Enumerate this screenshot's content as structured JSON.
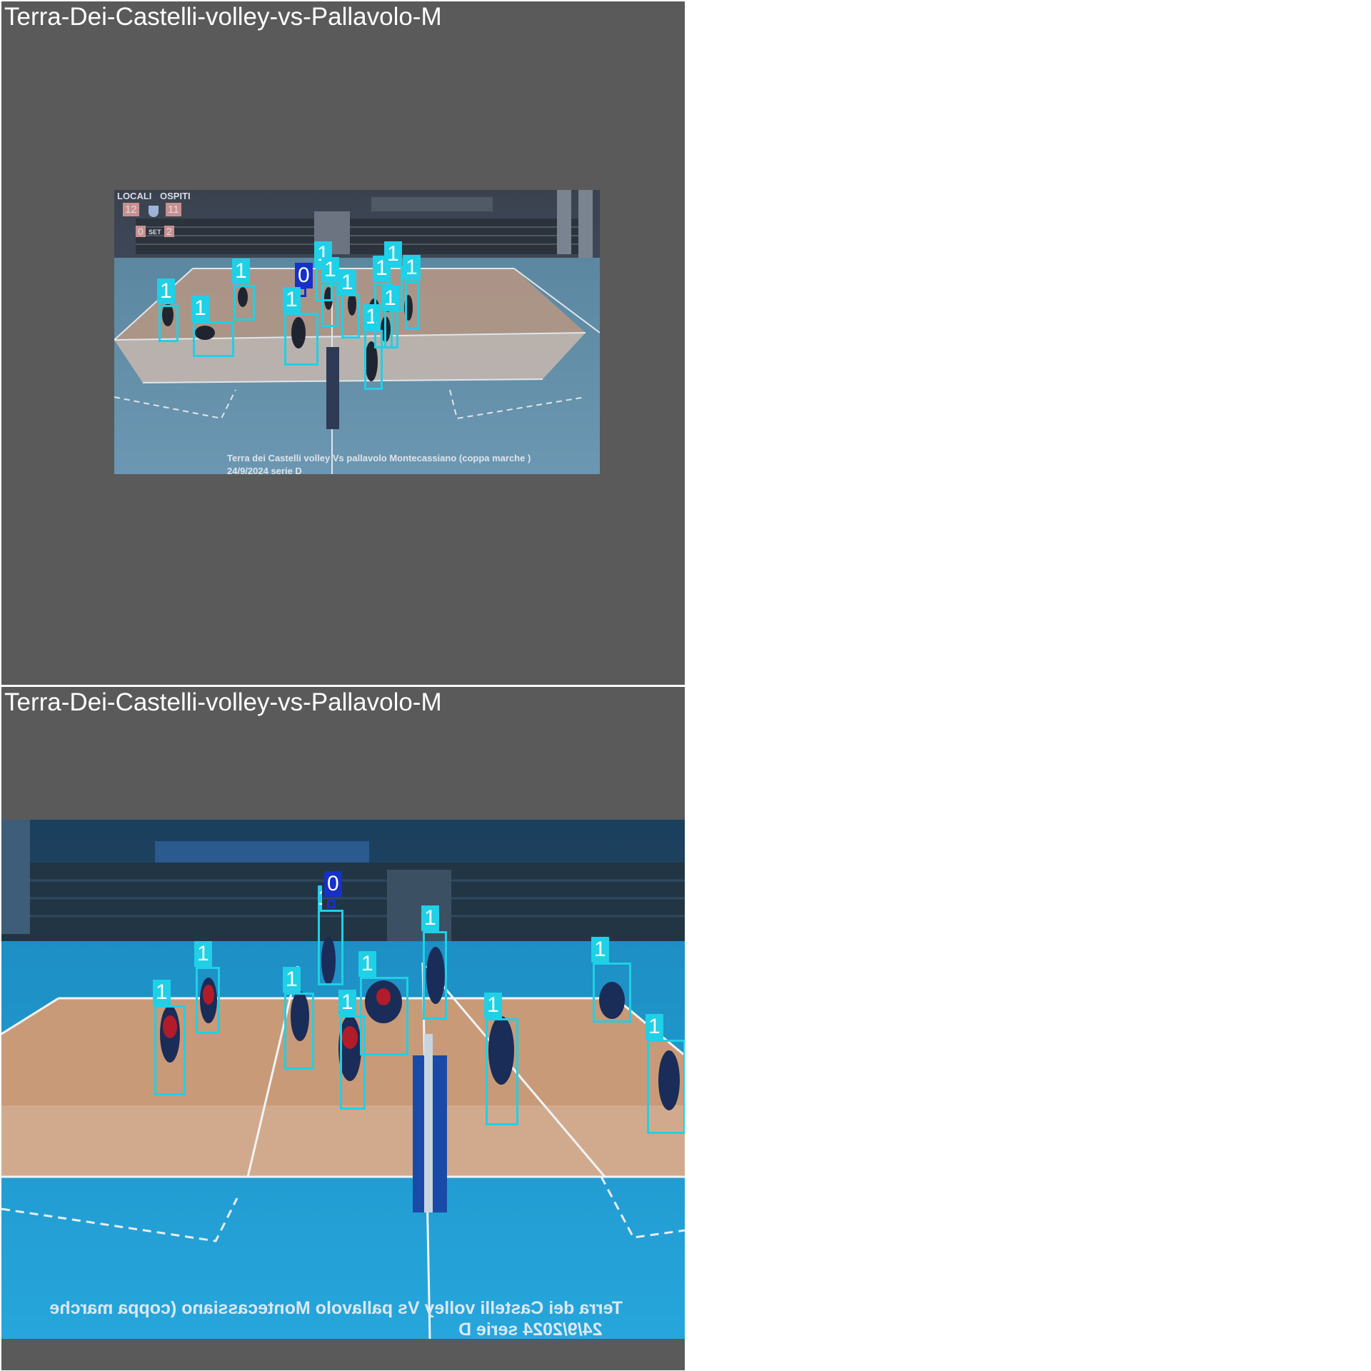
{
  "panels": [
    {
      "title": "Terra-Dei-Castelli-volley-vs-Pallavolo-M",
      "scoreboard": {
        "home_label": "LOCALI",
        "away_label": "OSPITI",
        "home_points": "12",
        "away_points": "11",
        "home_sets": "0",
        "set_label": "SET",
        "away_sets": "2"
      },
      "caption_line1": "Terra dei Castelli  volley  Vs  pallavolo Montecassiano   (coppa marche  )",
      "caption_line2": "24/9/2024   serie D",
      "detections": [
        "1",
        "1",
        "1",
        "0",
        "1",
        "1",
        "1",
        "1",
        "1",
        "1",
        "1",
        "1",
        "1"
      ]
    },
    {
      "title": "Terra-Dei-Castelli-volley-vs-Pallavolo-M",
      "caption_line1": "Terra dei Castelli  volley  Vs  pallavolo Montecassiano   (coppa marche",
      "caption_line2": "24/9/2024   serie D",
      "detections": [
        "0",
        "1",
        "1",
        "1",
        "1",
        "1",
        "1",
        "1",
        "1",
        "1"
      ]
    }
  ],
  "colors": {
    "class_1": "#1fd0e6",
    "class_0": "#1630c8",
    "panel_bg": "#5a5a5a"
  }
}
